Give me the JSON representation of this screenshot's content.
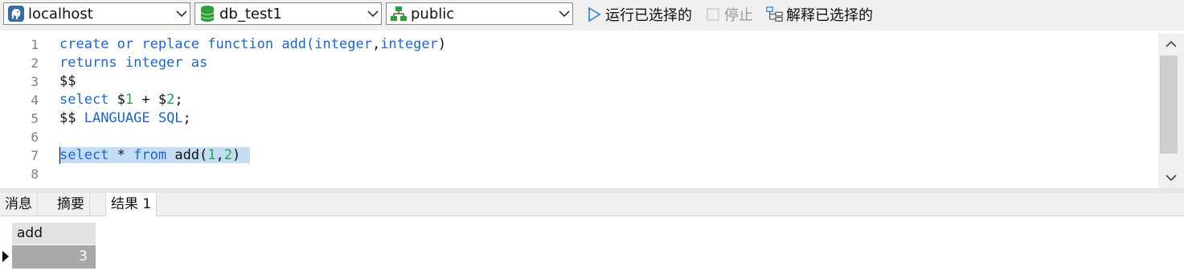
{
  "toolbar": {
    "connection": {
      "value": "localhost",
      "icon": "postgresql-elephant-icon"
    },
    "database": {
      "value": "db_test1",
      "icon": "database-cylinder-icon"
    },
    "schema": {
      "value": "public",
      "icon": "schema-tree-icon"
    },
    "run_selected_label": "运行已选择的",
    "stop_label": "停止",
    "explain_selected_label": "解释已选择的"
  },
  "editor": {
    "line_numbers": [
      "1",
      "2",
      "3",
      "4",
      "5",
      "6",
      "7",
      "8"
    ],
    "lines": {
      "l1": {
        "a": "create or replace function add(",
        "b": "integer",
        "c": ",",
        "d": "integer",
        "e": ")"
      },
      "l2": {
        "a": "returns integer as"
      },
      "l3": {
        "a": "$$"
      },
      "l4": {
        "a": "select",
        "b": " $",
        "c": "1",
        "d": " + $",
        "e": "2",
        "f": ";"
      },
      "l5": {
        "a": "$$ ",
        "b": "LANGUAGE SQL",
        "c": ";"
      },
      "l6": {
        "a": ""
      },
      "l7": {
        "a": "select",
        "b": " * ",
        "c": "from",
        "d": " add(",
        "e": "1",
        "f": ",",
        "g": "2",
        "h": ")"
      },
      "l8": {
        "a": ""
      }
    },
    "colors": {
      "keyword": "#1e66c8",
      "number": "#21a545",
      "selection": "#c4dcf4"
    }
  },
  "results": {
    "tabs": [
      "消息",
      "摘要",
      "结果 1"
    ],
    "active_tab": "结果 1",
    "columns": [
      "add"
    ],
    "rows": [
      [
        "3"
      ]
    ]
  }
}
